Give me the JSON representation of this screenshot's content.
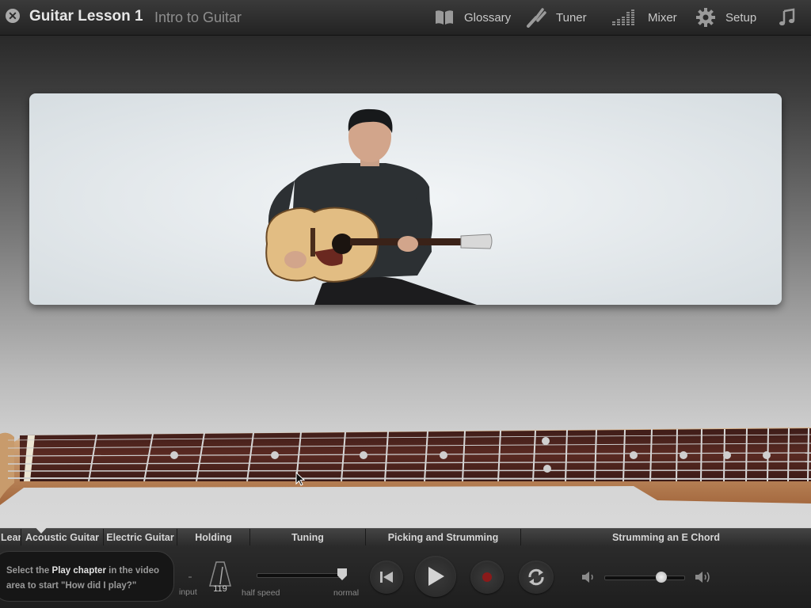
{
  "header": {
    "close_icon": "close-icon",
    "title": "Guitar Lesson 1",
    "subtitle": "Intro to Guitar",
    "buttons": [
      {
        "label": "Glossary",
        "icon": "book-icon"
      },
      {
        "label": "Tuner",
        "icon": "tuning-fork-icon"
      },
      {
        "label": "Mixer",
        "icon": "mixer-icon"
      },
      {
        "label": "Setup",
        "icon": "gear-icon"
      },
      {
        "label": "",
        "icon": "music-note-icon"
      }
    ]
  },
  "chapters": [
    "Lear",
    "Acoustic Guitar",
    "Electric Guitar",
    "Holding",
    "Tuning",
    "Picking and Strumming",
    "Strumming an E Chord"
  ],
  "controls": {
    "hint_prefix": "Select the ",
    "hint_bold": "Play chapter",
    "hint_suffix": " in the video area to start \"How did I play?\"",
    "input_label": "input",
    "tempo_value": "119",
    "speed_min_label": "half speed",
    "speed_max_label": "normal",
    "speed_level": 1.0,
    "volume_level": 0.72
  },
  "colors": {
    "accent_record": "#8a1a1a",
    "fretboard": "#5a2a22"
  }
}
